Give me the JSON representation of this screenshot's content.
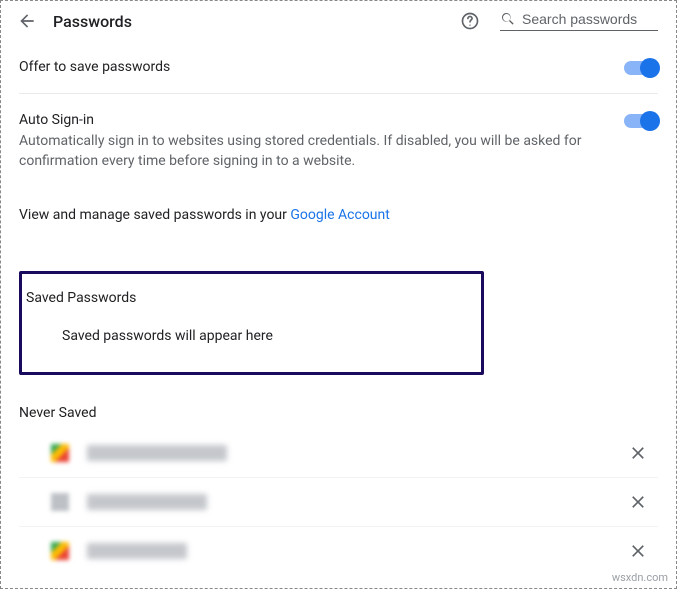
{
  "header": {
    "title": "Passwords",
    "search_placeholder": "Search passwords"
  },
  "settings": {
    "offer_save": {
      "label": "Offer to save passwords",
      "enabled": true
    },
    "auto_signin": {
      "label": "Auto Sign-in",
      "description": "Automatically sign in to websites using stored credentials. If disabled, you will be asked for confirmation every time before signing in to a website.",
      "enabled": true
    },
    "manage_prefix": "View and manage saved passwords in your ",
    "manage_link": "Google Account"
  },
  "saved_passwords": {
    "title": "Saved Passwords",
    "empty": "Saved passwords will appear here"
  },
  "never_saved": {
    "title": "Never Saved",
    "items": [
      {
        "site": "(redacted site 1)"
      },
      {
        "site": "(redacted site 2)"
      },
      {
        "site": "(redacted site 3)"
      }
    ]
  },
  "watermark": "wsxdn.com"
}
